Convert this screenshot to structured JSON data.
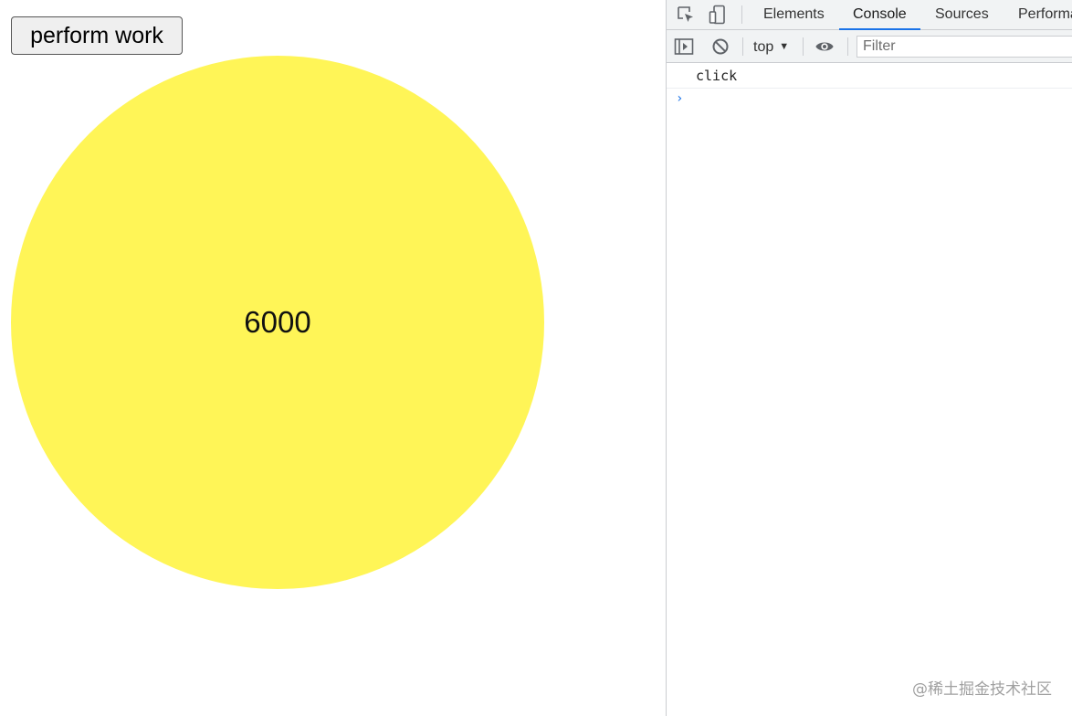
{
  "page": {
    "button_label": "perform work",
    "circle_value": "6000",
    "circle_color": "#fff557"
  },
  "devtools": {
    "tabs": [
      {
        "label": "Elements",
        "active": false
      },
      {
        "label": "Console",
        "active": true
      },
      {
        "label": "Sources",
        "active": false
      },
      {
        "label": "Performa",
        "active": false
      }
    ],
    "icons": {
      "inspect": "inspect-element-icon",
      "device": "device-toolbar-icon",
      "sidebar": "console-sidebar-icon",
      "clear": "clear-console-icon",
      "eye": "live-expression-eye-icon"
    },
    "context": "top",
    "filter_placeholder": "Filter",
    "accent_color": "#1a73e8",
    "console_messages": [
      "click"
    ],
    "prompt": "›"
  },
  "watermark": "@稀土掘金技术社区"
}
